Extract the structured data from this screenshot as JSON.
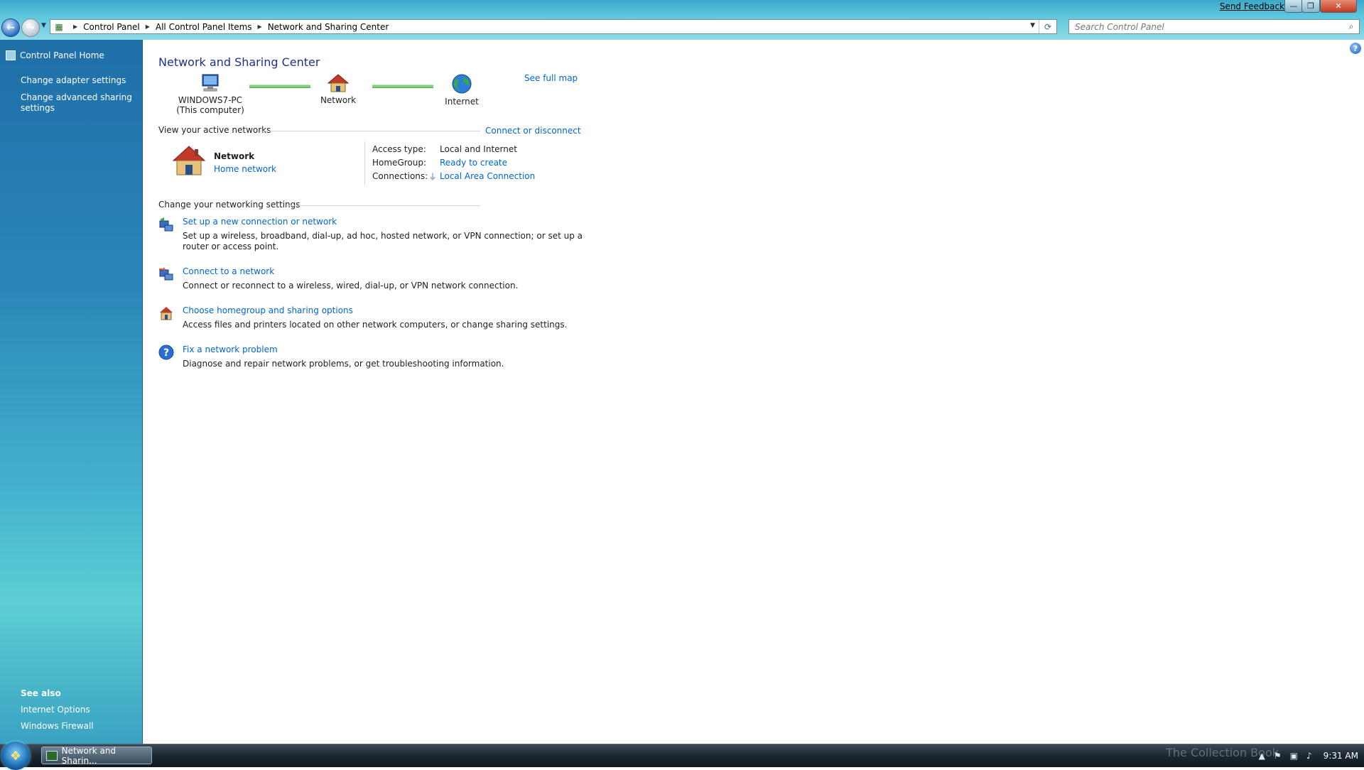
{
  "window": {
    "send_feedback": "Send Feedback",
    "minimize_glyph": "—",
    "maximize_glyph": "❐",
    "close_glyph": "✕"
  },
  "navigation": {
    "back_glyph": "←",
    "forward_glyph": "→",
    "dropdown_glyph": "▼"
  },
  "address_bar": {
    "breadcrumbs": [
      "Control Panel",
      "All Control Panel Items",
      "Network and Sharing Center"
    ],
    "separator_glyph": "▶",
    "refresh_glyph": "⟳"
  },
  "search": {
    "placeholder": "Search Control Panel",
    "icon": "search-icon"
  },
  "sidebar": {
    "home": "Control Panel Home",
    "links": [
      "Change adapter settings",
      "Change advanced sharing settings"
    ],
    "see_also_title": "See also",
    "see_also": [
      "Internet Options",
      "Windows Firewall"
    ]
  },
  "main": {
    "title": "Network and Sharing Center",
    "help_glyph": "?",
    "map": {
      "nodes": [
        {
          "label": "WINDOWS7-PC",
          "sub": "(This computer)",
          "icon": "computer-icon"
        },
        {
          "label": "Network",
          "sub": "",
          "icon": "house-icon"
        },
        {
          "label": "Internet",
          "sub": "",
          "icon": "globe-icon"
        }
      ],
      "see_full_map": "See full map"
    },
    "active_networks": {
      "header": "View your active networks",
      "connect_disconnect": "Connect or disconnect",
      "network_name": "Network",
      "network_type": "Home network",
      "properties": [
        {
          "label": "Access type:",
          "value": "Local and Internet",
          "is_link": false
        },
        {
          "label": "HomeGroup:",
          "value": "Ready to create",
          "is_link": true
        },
        {
          "label": "Connections:",
          "value": "Local Area Connection",
          "is_link": true
        }
      ]
    },
    "settings": {
      "header": "Change your networking settings",
      "tasks": [
        {
          "title": "Set up a new connection or network",
          "desc": "Set up a wireless, broadband, dial-up, ad hoc, hosted network, or VPN connection; or set up a router or access point.",
          "icon": "new-connection-icon"
        },
        {
          "title": "Connect to a network",
          "desc": "Connect or reconnect to a wireless, wired, dial-up, or VPN network connection.",
          "icon": "connect-network-icon"
        },
        {
          "title": "Choose homegroup and sharing options",
          "desc": "Access files and printers located on other network computers, or change sharing settings.",
          "icon": "homegroup-icon"
        },
        {
          "title": "Fix a network problem",
          "desc": "Diagnose and repair network problems, or get troubleshooting information.",
          "icon": "troubleshoot-icon"
        }
      ]
    }
  },
  "taskbar": {
    "window_label": "Network and Sharin...",
    "watermark": "The Collection Book",
    "tray_show_hidden_glyph": "▲",
    "clock": "9:31 AM"
  },
  "colors": {
    "link": "#0066cc",
    "title": "#1e3287",
    "sidebar_top": "#1f6fa8",
    "sidebar_bottom": "#5ccfd3"
  }
}
